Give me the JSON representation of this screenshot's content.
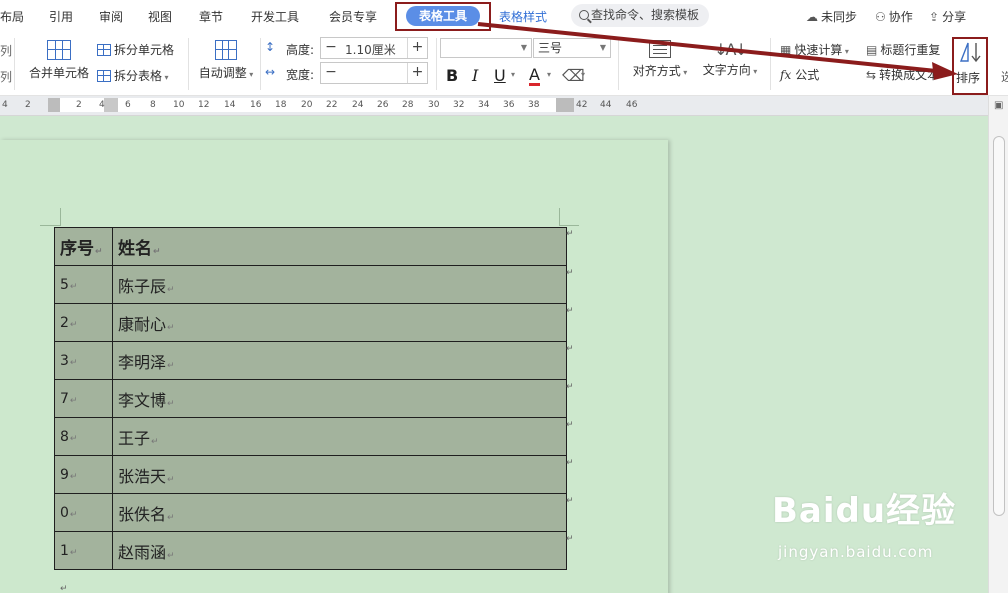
{
  "menubar": {
    "items": [
      "布局",
      "引用",
      "审阅",
      "视图",
      "章节",
      "开发工具",
      "会员专享"
    ],
    "active_tab": "表格工具",
    "table_style_tab": "表格样式",
    "search_label": "查找命令、搜索模板",
    "sync_label": "未同步",
    "collab_label": "协作",
    "share_label": "分享"
  },
  "ribbon": {
    "left_partial_1": "列",
    "left_partial_2": "列",
    "merge_cells": "合并单元格",
    "split_cells": "拆分单元格",
    "split_table": "拆分表格",
    "auto_adjust": "自动调整",
    "height_label": "高度:",
    "height_value": "1.10厘米",
    "width_label": "宽度:",
    "width_value": "",
    "font_name": "",
    "font_size": "三号",
    "bold": "B",
    "italic": "I",
    "underline": "U",
    "font_color": "A",
    "align": "对齐方式",
    "text_direction": "文字方向",
    "quick_calc": "快速计算",
    "formula": "公式",
    "header_repeat": "标题行重复",
    "convert_text": "转换成文本",
    "sort": "排序",
    "right_partial": "选"
  },
  "ruler": {
    "numbers": [
      "4",
      "2",
      "2",
      "4",
      "6",
      "8",
      "10",
      "12",
      "14",
      "16",
      "18",
      "20",
      "22",
      "24",
      "26",
      "28",
      "30",
      "32",
      "34",
      "36",
      "38",
      "42",
      "44",
      "46"
    ]
  },
  "table": {
    "header": [
      "序号",
      "姓名"
    ],
    "rows": [
      [
        "5",
        "陈子辰"
      ],
      [
        "2",
        "康耐心"
      ],
      [
        "3",
        "李明泽"
      ],
      [
        "7",
        "李文博"
      ],
      [
        "8",
        "王子"
      ],
      [
        "9",
        "张浩天"
      ],
      [
        "0",
        "张佚名"
      ],
      [
        "1",
        "赵雨涵"
      ]
    ]
  },
  "watermark": {
    "brand": "Baidu经验",
    "url": "jingyan.baidu.com"
  },
  "colors": {
    "annotation_red": "#8b1c1c",
    "active_tab_blue": "#5b8ee6",
    "link_blue": "#3370d6",
    "doc_background": "#cfe8d0",
    "table_fill": "#a3b39d"
  }
}
